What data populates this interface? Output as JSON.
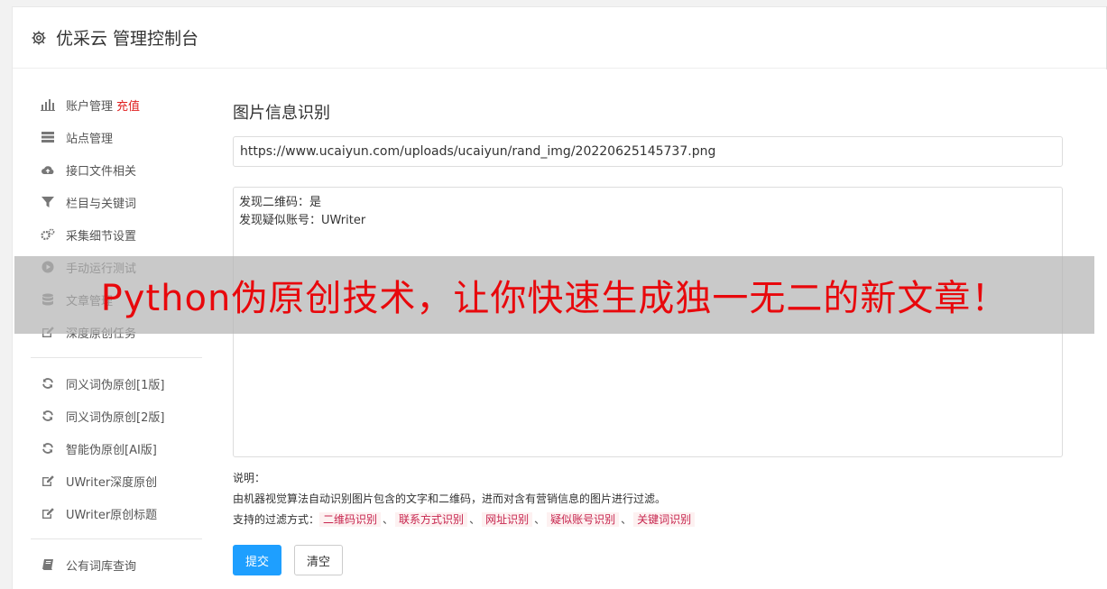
{
  "header": {
    "title": "优采云 管理控制台"
  },
  "sidebar": {
    "groups": [
      [
        {
          "label": "账户管理",
          "badge": "充值",
          "icon": "bar-chart-icon"
        },
        {
          "label": "站点管理",
          "icon": "server-icon"
        },
        {
          "label": "接口文件相关",
          "icon": "cloud-upload-icon"
        },
        {
          "label": "栏目与关键词",
          "icon": "filter-icon"
        },
        {
          "label": "采集细节设置",
          "icon": "gears-icon"
        },
        {
          "label": "手动运行测试",
          "icon": "play-circle-icon"
        },
        {
          "label": "文章管理",
          "icon": "database-icon"
        },
        {
          "label": "深度原创任务",
          "icon": "edit-icon"
        }
      ],
      [
        {
          "label": "同义词伪原创[1版]",
          "icon": "refresh-icon"
        },
        {
          "label": "同义词伪原创[2版]",
          "icon": "refresh-icon"
        },
        {
          "label": "智能伪原创[AI版]",
          "icon": "refresh-icon"
        },
        {
          "label": "UWriter深度原创",
          "icon": "edit-icon"
        },
        {
          "label": "UWriter原创标题",
          "icon": "edit-icon"
        }
      ],
      [
        {
          "label": "公有词库查询",
          "icon": "book-icon"
        }
      ]
    ]
  },
  "main": {
    "title": "图片信息识别",
    "url_value": "https://www.ucaiyun.com/uploads/ucaiyun/rand_img/20220625145737.png",
    "result_lines": [
      "发现二维码：是",
      "发现疑似账号：UWriter"
    ],
    "desc_label": "说明：",
    "desc_text": "由机器视觉算法自动识别图片包含的文字和二维码，进而对含有营销信息的图片进行过滤。",
    "filter_label": "支持的过滤方式：",
    "filters": [
      "二维码识别",
      "联系方式识别",
      "网址识别",
      "疑似账号识别",
      "关键词识别"
    ],
    "filter_sep": "、",
    "submit_label": "提交",
    "clear_label": "清空"
  },
  "overlay": {
    "text": "Python伪原创技术，让你快速生成独一无二的新文章！"
  },
  "colors": {
    "primary": "#1e9fff",
    "badge": "#e02020",
    "tag_text": "#c7254e",
    "banner_text": "#e8080c"
  }
}
